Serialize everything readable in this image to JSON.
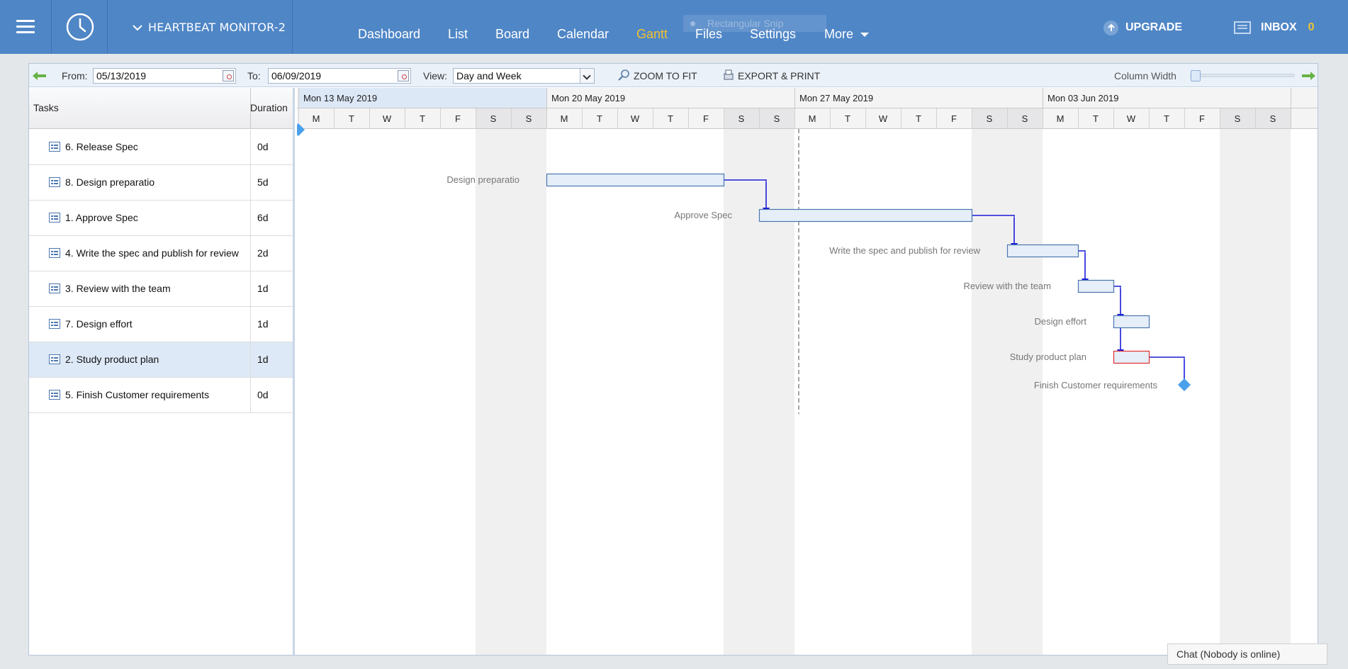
{
  "header": {
    "project": "HEARTBEAT MONITOR-2",
    "nav": [
      "Dashboard",
      "List",
      "Board",
      "Calendar",
      "Gantt",
      "Files",
      "Settings",
      "More"
    ],
    "active_nav": "Gantt",
    "snip_label": "Rectangular Snip",
    "upgrade": "UPGRADE",
    "inbox": "INBOX",
    "inbox_count": "0",
    "colors": {
      "bar": "#4f86c6",
      "active": "#f1c232"
    },
    "icons": [
      "menu-icon",
      "clock-icon",
      "chevron-down-icon",
      "upgrade-arrow-icon",
      "inbox-icon"
    ]
  },
  "toolbar": {
    "from_label": "From:",
    "from_value": "05/13/2019",
    "to_label": "To:",
    "to_value": "06/09/2019",
    "view_label": "View:",
    "view_value": "Day and Week",
    "zoom_label": "ZOOM TO FIT",
    "export_label": "EXPORT & PRINT",
    "column_width_label": "Column Width",
    "icons": [
      "back-arrow-icon",
      "calendar-icon",
      "zoom-icon",
      "print-icon",
      "forward-arrow-icon"
    ]
  },
  "grid": {
    "col_tasks": "Tasks",
    "col_duration": "Duration",
    "rows": [
      {
        "name": "6. Release Spec",
        "duration": "0d"
      },
      {
        "name": "8. Design preparatio",
        "duration": "5d"
      },
      {
        "name": "1. Approve Spec",
        "duration": "6d"
      },
      {
        "name": "4. Write the spec and publish for review",
        "duration": "2d"
      },
      {
        "name": "3. Review with the team",
        "duration": "1d"
      },
      {
        "name": "7. Design effort",
        "duration": "1d"
      },
      {
        "name": "2. Study product plan",
        "duration": "1d"
      },
      {
        "name": "5. Finish Customer requirements",
        "duration": "0d"
      }
    ],
    "selected_row": 6
  },
  "chart_data": {
    "type": "gantt",
    "weeks": [
      "Mon 13 May 2019",
      "Mon 20 May 2019",
      "Mon 27 May 2019",
      "Mon 03 Jun 2019"
    ],
    "day_letters": [
      "M",
      "T",
      "W",
      "T",
      "F",
      "S",
      "S"
    ],
    "today_day": 14,
    "tasks": [
      {
        "label": "",
        "start": 0,
        "end": 0,
        "milestone": true
      },
      {
        "label": "Design preparatio",
        "start": 7,
        "end": 12
      },
      {
        "label": "Approve Spec",
        "start": 13,
        "end": 19
      },
      {
        "label": "Write the spec and publish for review",
        "start": 20,
        "end": 22
      },
      {
        "label": "Review with the team",
        "start": 22,
        "end": 23
      },
      {
        "label": "Design effort",
        "start": 23,
        "end": 24
      },
      {
        "label": "Study product plan",
        "start": 23,
        "end": 24,
        "critical": true
      },
      {
        "label": "Finish Customer requirements",
        "start": 25,
        "end": 25,
        "milestone": true
      }
    ],
    "links": [
      [
        1,
        2
      ],
      [
        2,
        3
      ],
      [
        3,
        4
      ],
      [
        4,
        5
      ],
      [
        5,
        6
      ],
      [
        6,
        7
      ]
    ]
  },
  "chat": {
    "label": "Chat (Nobody is online)"
  }
}
